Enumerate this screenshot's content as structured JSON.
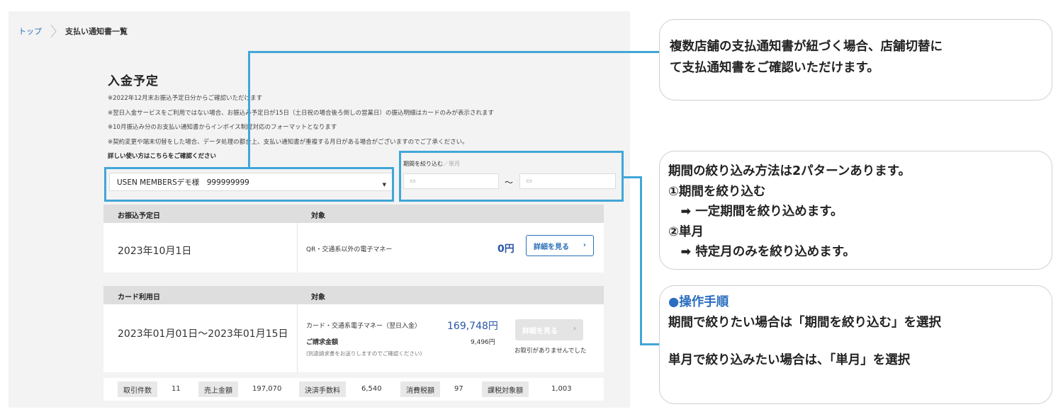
{
  "breadcrumb": {
    "home": "トップ",
    "current": "支払い通知書一覧"
  },
  "page": {
    "title": "入金予定",
    "notes": [
      "※2022年12月末お振込予定日分からご確認いただけます",
      "※翌日入金サービスをご利用ではない場合、お振込み予定日が15日（土日祝の場合後ろ倒しの営業日）の振込明細はカードのみが表示されます",
      "※10月振込み分のお支払い通知書からインボイス制度対応のフォーマットとなります",
      "※契約変更や端末切替をした場合、データ処理の都合上、支払い通知書が重複する月日がある場合がございますのでご了承ください。"
    ],
    "help_link": "詳しい使い方はこちらをご確認ください"
  },
  "filters": {
    "store_select_value": "USEN MEMBERSデモ様　999999999",
    "period_label": "期間を絞り込む",
    "period_sep": "／",
    "period_alt": "単月",
    "date_separator": "～"
  },
  "transfer_card": {
    "col1_header": "お振込予定日",
    "col2_header": "対象",
    "date": "2023年10月1日",
    "target": "QR・交通系以外の電子マネー",
    "amount": "0円",
    "detail_button": "詳細を見る"
  },
  "card_usage": {
    "col1_header": "カード利用日",
    "col2_header": "対象",
    "date_range": "2023年01月01日～2023年01月15日",
    "target": "カード・交通系電子マネー（翌日入金）",
    "amount": "169,748円",
    "billing_label": "ご請求金額",
    "billing_amount": "9,496円",
    "billing_note": "(別途請求書をお送りしますのでご確認ください)",
    "detail_button": "詳細を見る",
    "no_transactions": "お取引がありませんでした"
  },
  "stats": [
    {
      "label": "取引件数",
      "value": "11"
    },
    {
      "label": "売上金額",
      "value": "197,070"
    },
    {
      "label": "決済手数料",
      "value": "6,540"
    },
    {
      "label": "消費税額",
      "value": "97"
    },
    {
      "label": "課税対象額",
      "value": "1,003"
    }
  ],
  "callouts": {
    "store_switch": [
      "複数店舗の支払通知書が紐づく場合、店舗切替に",
      "て支払通知書をご確認いただけます。"
    ],
    "period_patterns": [
      "期間の絞り込み方法は2パターンあります。",
      "①期間を絞り込む",
      "　➡ 一定期間を絞り込めます。",
      "②単月",
      "　➡ 特定月のみを絞り込めます。"
    ],
    "steps_title": "●操作手順",
    "steps_line1": "期間で絞りたい場合は「期間を絞り込む」を選択",
    "steps_line2": "単月で絞り込みたい場合は、「単月」を選択"
  },
  "colors": {
    "highlight": "#41a6d8",
    "link": "#2a6fb7",
    "amount": "#2a55a8"
  }
}
